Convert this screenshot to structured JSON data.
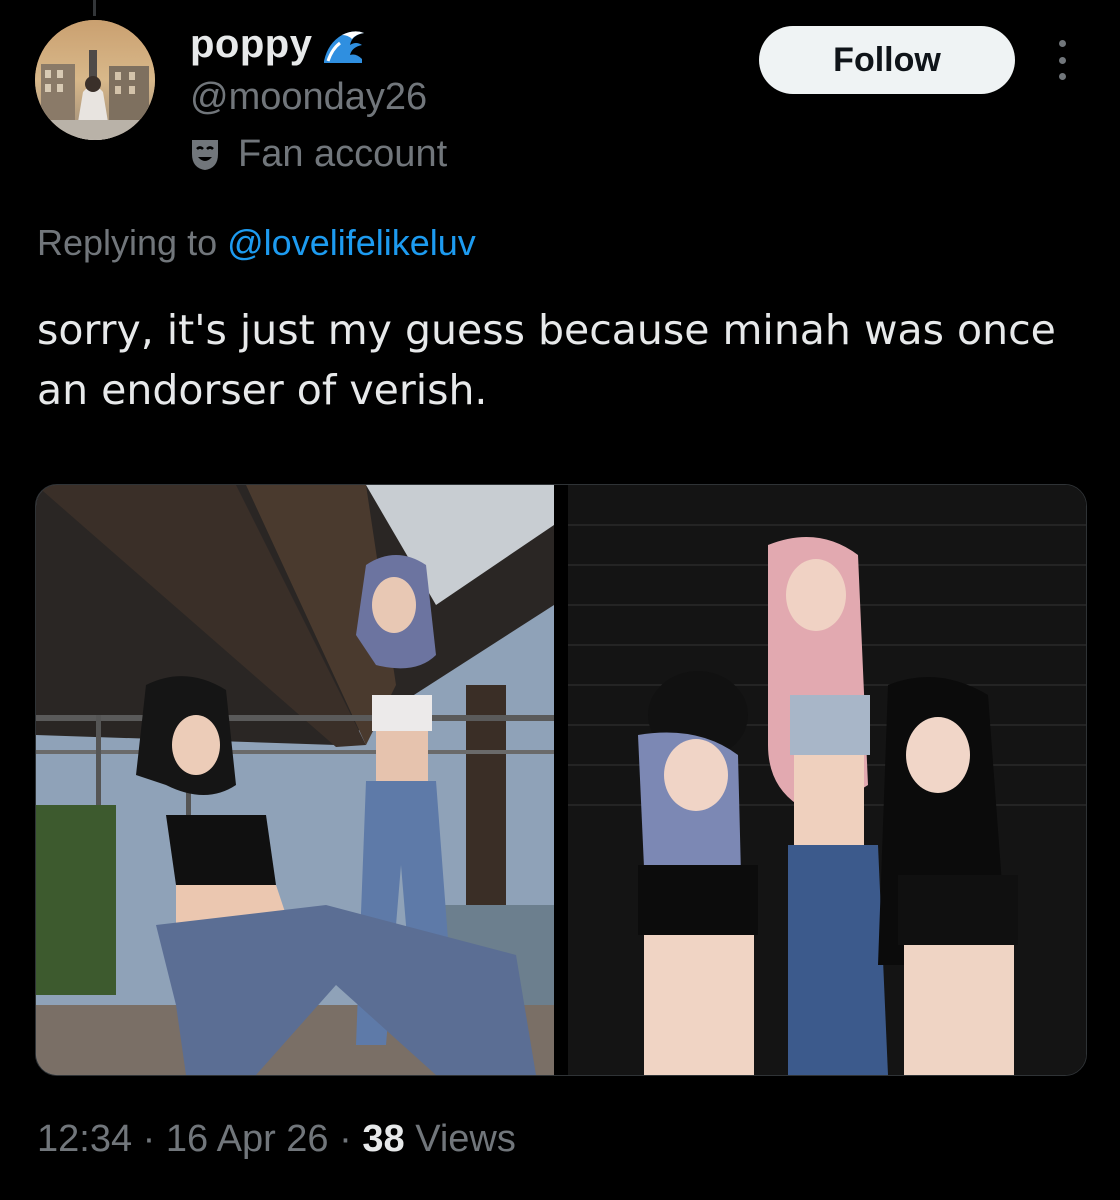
{
  "author": {
    "display_name": "poppy",
    "badge_icon": "wave-emoji-icon",
    "handle": "@moonday26",
    "label": "Fan account",
    "label_icon": "theater-mask-icon"
  },
  "follow_label": "Follow",
  "reply": {
    "prefix": "Replying to",
    "mention": "@lovelifelikeluv"
  },
  "tweet_text": "sorry, it's just my guess because minah was once an endorser of verish.",
  "media": [
    {
      "icon": "photo-two-women-under-bridge"
    },
    {
      "icon": "photo-three-women-brick-wall"
    }
  ],
  "meta": {
    "time": "12:34",
    "sep1": "·",
    "date": "16 Apr 26",
    "sep2": "·",
    "views_count": "38",
    "views_label": "Views"
  },
  "colors": {
    "background": "#000000",
    "text": "#e7e9ea",
    "secondary": "#71767b",
    "link": "#1d9bf0",
    "button_bg": "#eff3f4"
  }
}
